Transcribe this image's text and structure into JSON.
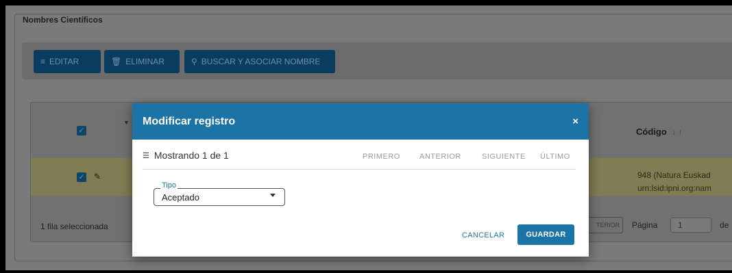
{
  "section": {
    "title": "Nombres Científicos"
  },
  "toolbar": {
    "editar": "EDITAR",
    "eliminar": "ELIMINAR",
    "buscar": "BUSCAR Y ASOCIAR NOMBRE"
  },
  "table": {
    "col_codigo": "Código",
    "rows": [
      {
        "codigo_line1": "948 (Natura Euskad",
        "codigo_line2": "urn:lsid:ipni.org:nam"
      }
    ]
  },
  "footer": {
    "selected": "1 fila seleccionada",
    "anterior": "TERIOR",
    "pagina_label": "Página",
    "pagina_value": "1",
    "de": "de"
  },
  "modal": {
    "title": "Modificar registro",
    "close": "×",
    "showing": "Mostrando 1 de 1",
    "nav": {
      "primero": "PRIMERO",
      "anterior": "ANTERIOR",
      "siguiente": "SIGUIENTE",
      "ultimo": "ÚLTIMO"
    },
    "tipo": {
      "label": "Tipo",
      "value": "Aceptado"
    },
    "cancel": "CANCELAR",
    "save": "GUARDAR"
  }
}
